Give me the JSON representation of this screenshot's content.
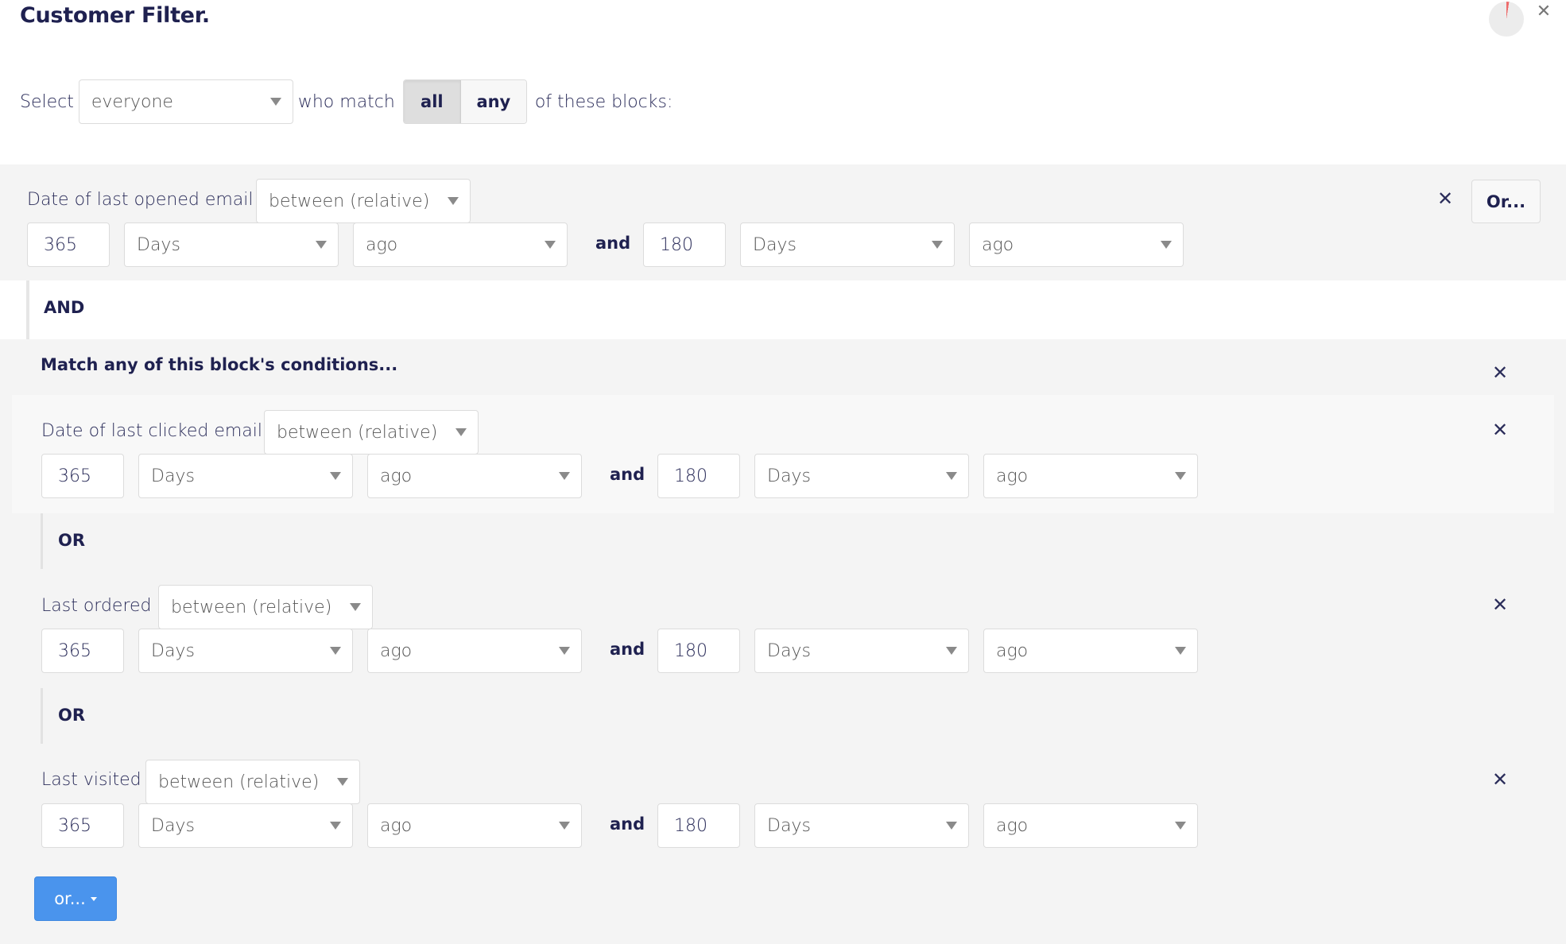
{
  "header": {
    "title": "Customer Filter.",
    "progress_fraction": 0.025,
    "progress_color": "#ee6b6b",
    "close_icon": "close-icon"
  },
  "select_row": {
    "select_label": "Select",
    "audience_value": "everyone",
    "who_match_label": "who match",
    "match_options": [
      {
        "label": "all",
        "active": true
      },
      {
        "label": "any",
        "active": false
      }
    ],
    "suffix_label": "of these blocks:"
  },
  "blocks": [
    {
      "conditions": [
        {
          "field": "Date of last opened email",
          "operator": "between (relative)",
          "from": {
            "amount": "365",
            "unit": "Days",
            "direction": "ago"
          },
          "connector": "and",
          "to": {
            "amount": "180",
            "unit": "Days",
            "direction": "ago"
          }
        }
      ],
      "or_button_label": "Or..."
    },
    {
      "header": "Match any of this block's conditions...",
      "conditions": [
        {
          "field": "Date of last clicked email",
          "operator": "between (relative)",
          "from": {
            "amount": "365",
            "unit": "Days",
            "direction": "ago"
          },
          "connector": "and",
          "to": {
            "amount": "180",
            "unit": "Days",
            "direction": "ago"
          }
        },
        {
          "field": "Last ordered",
          "operator": "between (relative)",
          "from": {
            "amount": "365",
            "unit": "Days",
            "direction": "ago"
          },
          "connector": "and",
          "to": {
            "amount": "180",
            "unit": "Days",
            "direction": "ago"
          }
        },
        {
          "field": "Last visited",
          "operator": "between (relative)",
          "from": {
            "amount": "365",
            "unit": "Days",
            "direction": "ago"
          },
          "connector": "and",
          "to": {
            "amount": "180",
            "unit": "Days",
            "direction": "ago"
          }
        }
      ],
      "condition_separator": "OR",
      "add_or_button_label": "or..."
    }
  ],
  "block_separator": "AND",
  "colors": {
    "text_primary": "#1f2150",
    "block_bg": "#f4f4f4",
    "accent_blue": "#4a94ed"
  }
}
